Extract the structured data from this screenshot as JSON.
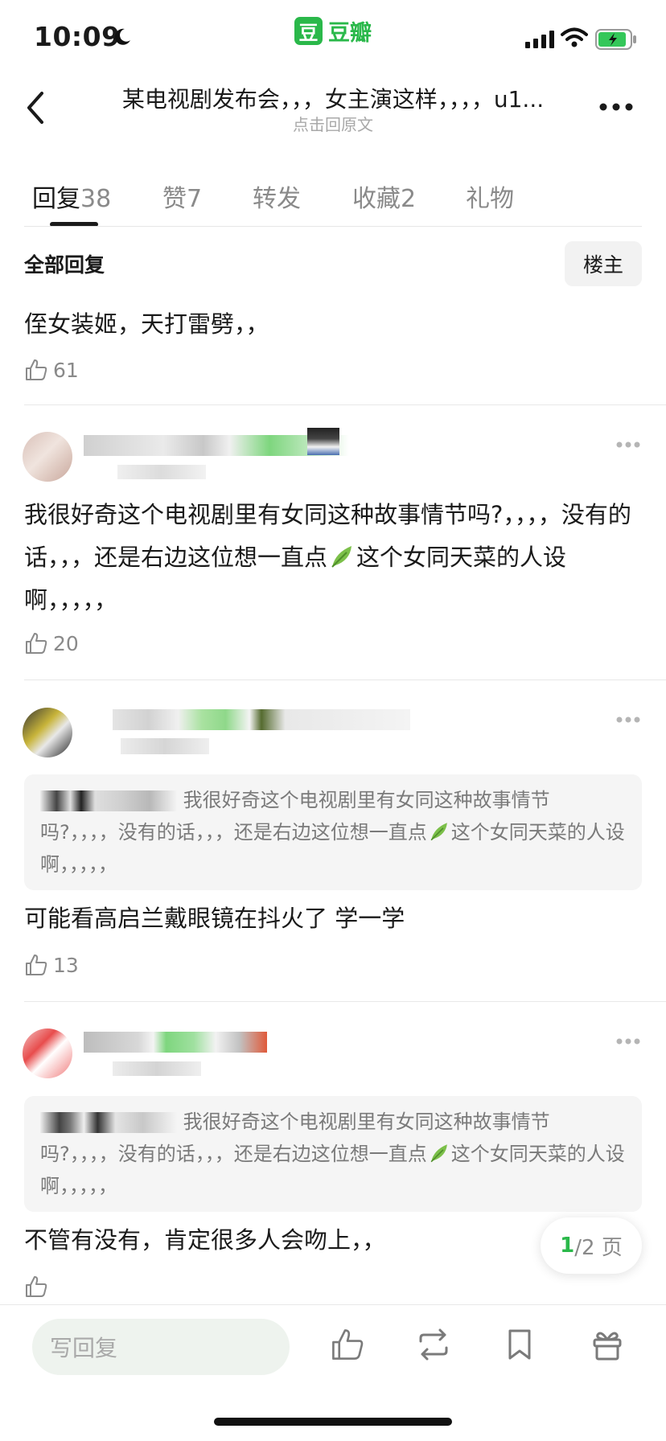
{
  "status_bar": {
    "time": "10:09",
    "app_logo_char": "豆",
    "app_name": "豆瓣"
  },
  "nav": {
    "title": "某电视剧发布会，，，女主演这样，，，，u1...",
    "subtitle": "点击回原文"
  },
  "tabs": [
    {
      "label": "回复",
      "count": "38",
      "active": true
    },
    {
      "label": "赞",
      "count": "7"
    },
    {
      "label": "转发",
      "count": ""
    },
    {
      "label": "收藏",
      "count": "2"
    },
    {
      "label": "礼物",
      "count": ""
    }
  ],
  "filter": {
    "label": "全部回复",
    "owner_button": "楼主"
  },
  "comments": [
    {
      "text": "侄女装姬，天打雷劈，，",
      "likes": "61"
    },
    {
      "text_parts": [
        "我很好奇这个电视剧里有女同这种故事情节吗?，，，，没有的话，，，还是右边这位想一直点",
        "这个女同天菜的人设啊，，，，，"
      ],
      "likes": "20"
    },
    {
      "quote_parts": [
        "我很好奇这个电视剧里有女同这种故事情节吗?，，，，没有的话，，，还是右边这位想一直点",
        "这个女同天菜的人设啊，，，，，"
      ],
      "text": "可能看高启兰戴眼镜在抖火了  学一学",
      "likes": "13"
    },
    {
      "quote_parts": [
        "我很好奇这个电视剧里有女同这种故事情节吗?，，，，没有的话，，，还是右边这位想一直点",
        "这个女同天菜的人设啊，，，，，"
      ],
      "text": "不管有没有，肯定很多人会吻上，，",
      "likes": ""
    }
  ],
  "pagination": {
    "current": "1",
    "total_text": "/2 页"
  },
  "bottom_bar": {
    "reply_placeholder": "写回复"
  },
  "colors": {
    "accent": "#2ab84a",
    "text": "#1a1a1a",
    "muted": "#8a8a8a"
  },
  "icons": [
    "back-icon",
    "more-icon",
    "thumb-up-icon",
    "repost-icon",
    "bookmark-icon",
    "gift-icon",
    "leaf-icon"
  ]
}
